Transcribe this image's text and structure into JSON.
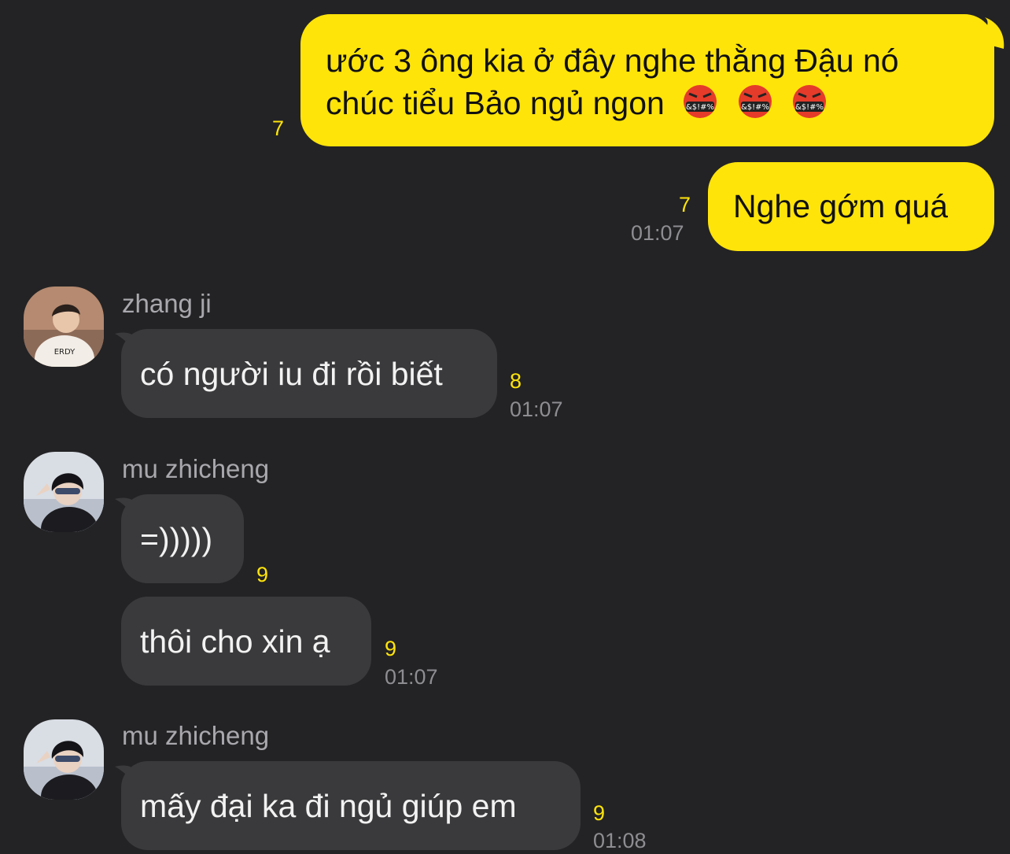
{
  "colors": {
    "background": "#232325",
    "outgoing_bubble": "#ffe40a",
    "incoming_bubble": "#3a3a3c",
    "unread_count": "#ffe40a",
    "timestamp": "#8e8e92"
  },
  "messages": {
    "m1": {
      "line1": "ước 3 ông kia ở đây nghe thằng Đậu nó",
      "line2": "chúc tiểu Bảo ngủ ngon",
      "emoji_icon": "face-with-symbols-on-mouth-icon",
      "unread": "7"
    },
    "m2": {
      "text": "Nghe gớm quá",
      "unread": "7",
      "time": "01:07"
    },
    "m3": {
      "sender": "zhang ji",
      "text": "có người iu đi rồi biết",
      "unread": "8",
      "time": "01:07"
    },
    "m4": {
      "sender": "mu zhicheng",
      "text1": "=)))))",
      "unread1": "9",
      "text2": "thôi cho xin ạ",
      "unread2": "9",
      "time2": "01:07"
    },
    "m5": {
      "sender": "mu zhicheng",
      "text": "mấy đại ka đi ngủ giúp em",
      "unread": "9",
      "time": "01:08"
    }
  }
}
